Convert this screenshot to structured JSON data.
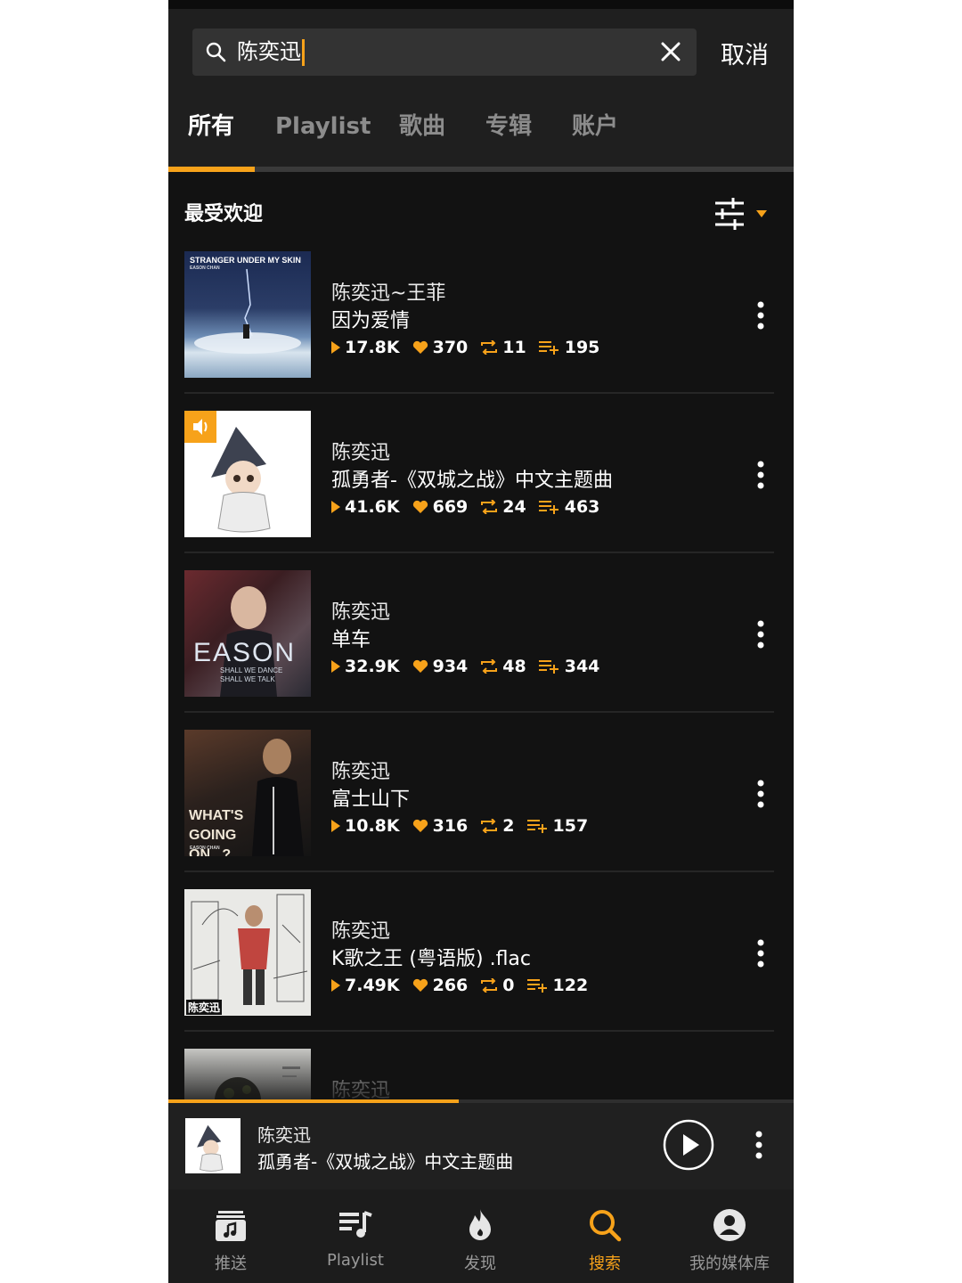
{
  "colors": {
    "accent": "#f7a21a",
    "background": "#121212",
    "header": "#1f1f1f"
  },
  "search": {
    "query": "陈奕迅",
    "cancel_label": "取消"
  },
  "tabs": [
    {
      "label": "所有",
      "active": true
    },
    {
      "label": "Playlist",
      "active": false
    },
    {
      "label": "歌曲",
      "active": false
    },
    {
      "label": "专辑",
      "active": false
    },
    {
      "label": "账户",
      "active": false
    }
  ],
  "section": {
    "title": "最受欢迎"
  },
  "results": [
    {
      "artist": "陈奕迅~王菲",
      "title": "因为爱情",
      "plays": "17.8K",
      "likes": "370",
      "reposts": "11",
      "playlists": "195",
      "cover_text": "STRANGER UNDER MY SKIN",
      "cover_subtext": "EASON CHAN"
    },
    {
      "artist": "陈奕迅",
      "title": "孤勇者-《双城之战》中文主题曲",
      "plays": "41.6K",
      "likes": "669",
      "reposts": "24",
      "playlists": "463",
      "now_playing": true
    },
    {
      "artist": "陈奕迅",
      "title": "单车",
      "plays": "32.9K",
      "likes": "934",
      "reposts": "48",
      "playlists": "344",
      "cover_text": "EASON",
      "cover_subtext": "SHALL WE DANCE SHALL WE TALK"
    },
    {
      "artist": "陈奕迅",
      "title": "富士山下",
      "plays": "10.8K",
      "likes": "316",
      "reposts": "2",
      "playlists": "157",
      "cover_text": "WHAT'S GOING ON...?",
      "cover_subtext": "EASON CHAN"
    },
    {
      "artist": "陈奕迅",
      "title": "K歌之王 (粤语版) .flac",
      "plays": "7.49K",
      "likes": "266",
      "reposts": "0",
      "playlists": "122",
      "cover_text": "陈奕迅"
    },
    {
      "artist": "陈奕迅",
      "title": ""
    }
  ],
  "player": {
    "artist": "陈奕迅",
    "title": "孤勇者-《双城之战》中文主题曲",
    "progress": 0.465
  },
  "nav": [
    {
      "label": "推送",
      "icon": "music-feed-icon",
      "active": false
    },
    {
      "label": "Playlist",
      "icon": "playlist-icon",
      "active": false
    },
    {
      "label": "发现",
      "icon": "flame-icon",
      "active": false
    },
    {
      "label": "搜索",
      "icon": "search-icon",
      "active": true
    },
    {
      "label": "我的媒体库",
      "icon": "profile-icon",
      "active": false
    }
  ]
}
